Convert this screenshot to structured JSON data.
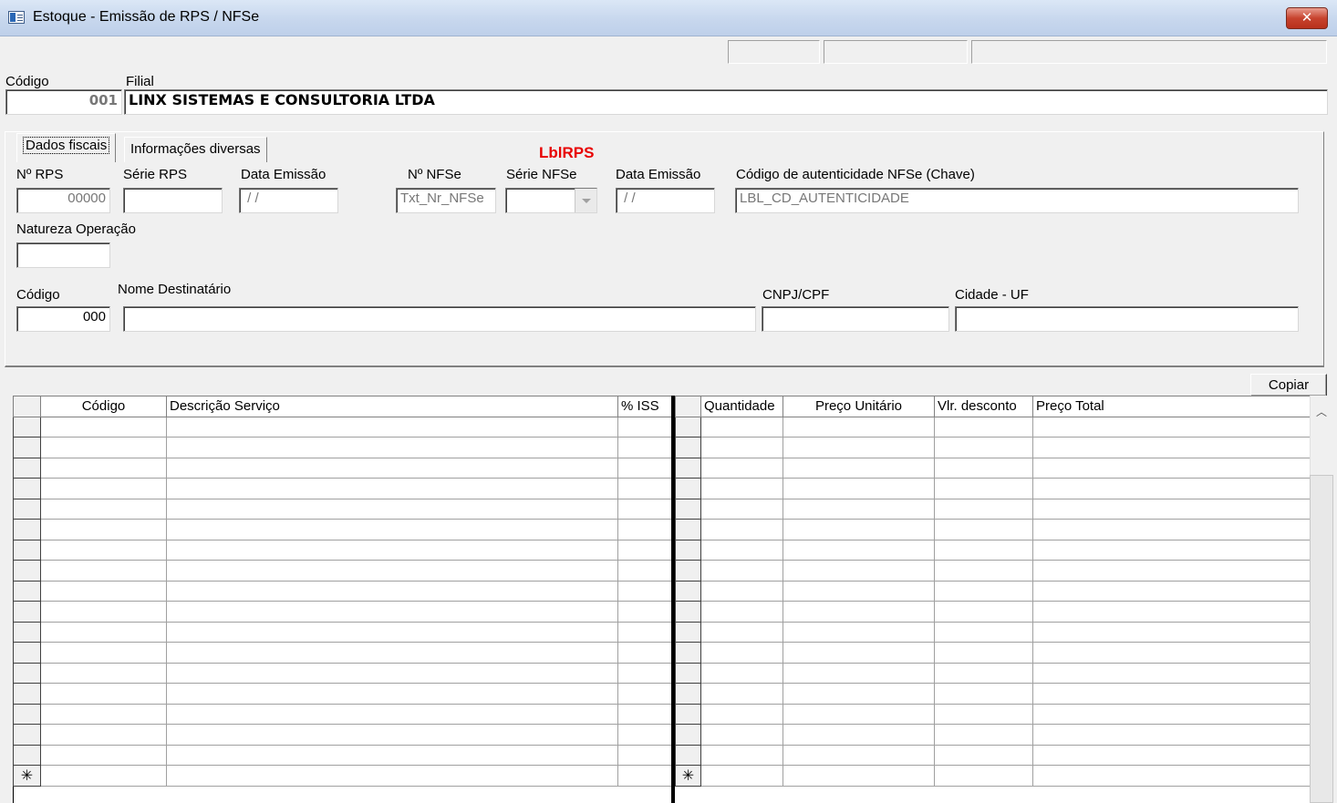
{
  "window": {
    "title": "Estoque - Emissão de RPS / NFSe",
    "close_label": "✕",
    "icon": "app-window-icon"
  },
  "header": {
    "codigo_label": "Código",
    "codigo_value": "001",
    "filial_label": "Filial",
    "filial_value": "LINX SISTEMAS E CONSULTORIA LTDA"
  },
  "tabs": [
    {
      "label": "Dados fiscais",
      "active": true
    },
    {
      "label": "Informações diversas",
      "active": false
    }
  ],
  "lbl_rps": "LblRPS",
  "fiscal": {
    "nr_rps_label": "Nº RPS",
    "nr_rps_value": "00000",
    "serie_rps_label": "Série RPS",
    "serie_rps_value": "",
    "data_emissao_label": "Data Emissão",
    "data_emissao_value": " / /",
    "nr_nfse_label": "Nº NFSe",
    "nr_nfse_value": "Txt_Nr_NFSe",
    "serie_nfse_label": "Série NFSe",
    "serie_nfse_value": "",
    "data_emissao_nfse_label": "Data Emissão",
    "data_emissao_nfse_value": " / /",
    "cod_autent_label": "Código de autenticidade NFSe (Chave)",
    "cod_autent_value": "LBL_CD_AUTENTICIDADE",
    "natureza_label": "Natureza  Operação",
    "natureza_value": "",
    "dest_codigo_label": "Código",
    "dest_codigo_value": "000",
    "nome_dest_label": "Nome Destinatário",
    "nome_dest_value": "",
    "cnpj_label": "CNPJ/CPF",
    "cnpj_value": "",
    "cidade_label": "Cidade - UF",
    "cidade_value": ""
  },
  "copiar_label": "Copiar",
  "grid_left": {
    "columns": [
      "Código",
      "Descrição Serviço",
      "% ISS"
    ],
    "new_row_marker": "✳"
  },
  "grid_right": {
    "columns": [
      "Quantidade",
      "Preço Unitário",
      "Vlr. desconto",
      "Preço Total"
    ],
    "new_row_marker": "✳"
  },
  "scroll_up_icon": "chevron-up-icon"
}
